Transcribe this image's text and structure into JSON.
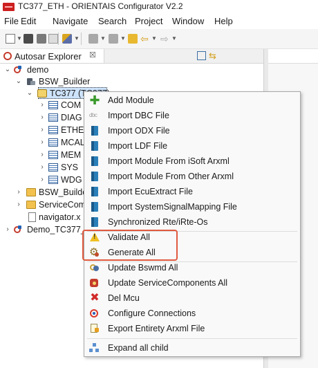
{
  "window": {
    "title": "TC377_ETH - ORIENTAIS Configurator V2.2"
  },
  "menubar": [
    "File",
    "Edit",
    "Navigate",
    "Search",
    "Project",
    "Window",
    "Help"
  ],
  "explorer": {
    "tab_label": "Autosar Explorer",
    "close_glyph": "☒",
    "tree": {
      "demo": "demo",
      "bsw_builder": "BSW_Builder",
      "tc377": "TC377 (TC377)",
      "modules": [
        "COM",
        "DIAG",
        "ETHER",
        "MCAL",
        "MEM",
        "SYS",
        "WDG"
      ],
      "bsw_builder_folder": "BSW_Builde",
      "service_components": "ServiceCom",
      "navigator": "navigator.x",
      "demo_tc377": "Demo_TC377_"
    }
  },
  "context_menu": {
    "items": [
      {
        "label": "Add Module",
        "icon": "add-icon"
      },
      {
        "label": "Import DBC File",
        "icon": "dbc-icon"
      },
      {
        "label": "Import ODX File",
        "icon": "document-icon"
      },
      {
        "label": "Import LDF File",
        "icon": "document-icon"
      },
      {
        "label": "Import Module From iSoft Arxml",
        "icon": "document-icon"
      },
      {
        "label": "Import Module From Other Arxml",
        "icon": "document-icon"
      },
      {
        "label": "Import EcuExtract File",
        "icon": "document-icon"
      },
      {
        "label": "Import SystemSignalMapping File",
        "icon": "document-icon"
      },
      {
        "label": "Synchronized Rte/iRte-Os",
        "icon": "document-icon"
      },
      {
        "label": "Validate All",
        "icon": "warning-icon"
      },
      {
        "label": "Generate All",
        "icon": "generate-icon"
      },
      {
        "label": "Update Bswmd All",
        "icon": "link-icon"
      },
      {
        "label": "Update ServiceComponents All",
        "icon": "service-icon"
      },
      {
        "label": "Del Mcu",
        "icon": "delete-icon"
      },
      {
        "label": "Configure Connections",
        "icon": "connection-icon"
      },
      {
        "label": "Export Entirety Arxml File",
        "icon": "export-icon"
      },
      {
        "label": "Expand all child",
        "icon": "tree-icon"
      }
    ]
  },
  "colors": {
    "highlight_box": "#e05a3f",
    "selection": "#cde3fb",
    "brand_red": "#cc1f1f"
  }
}
